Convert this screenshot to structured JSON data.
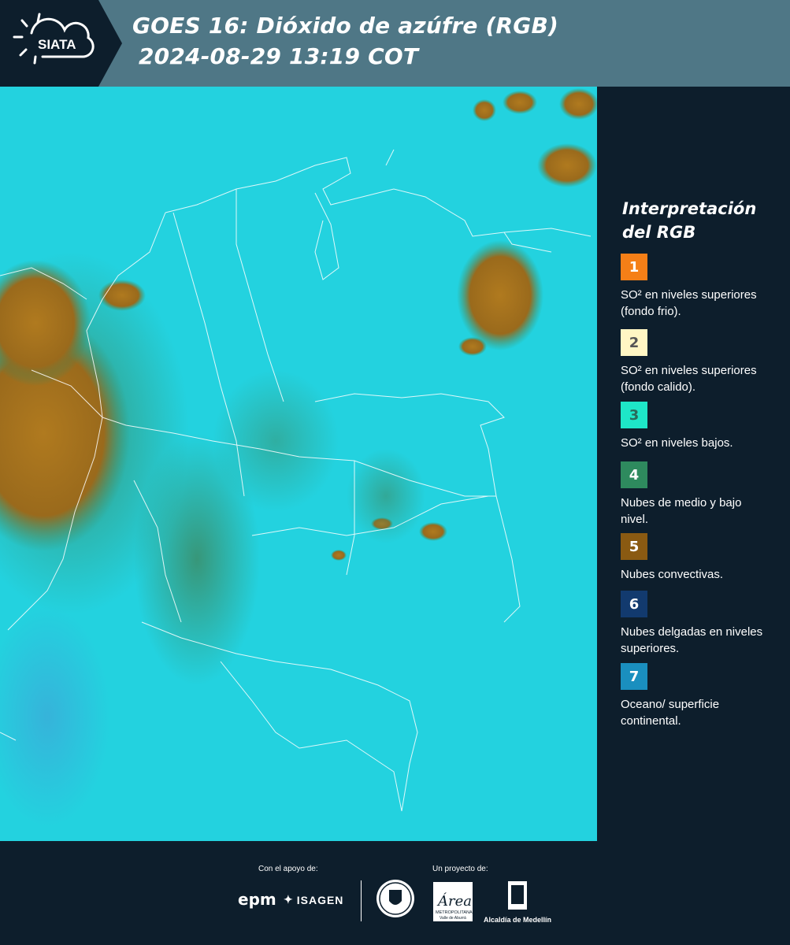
{
  "header": {
    "logo_text": "SIATA",
    "title_line1": "GOES 16: Dióxido de azúfre (RGB)",
    "title_line2": "2024-08-29 13:19 COT"
  },
  "legend": {
    "title_line1": "Interpretación",
    "title_line2": "del RGB",
    "items": [
      {
        "number": "1",
        "color": "#f57f17",
        "text": "SO² en niveles superiores (fondo frio)."
      },
      {
        "number": "2",
        "color": "#fff6c4",
        "text": "SO² en niveles superiores (fondo calido)."
      },
      {
        "number": "3",
        "color": "#1ee6c8",
        "text": "SO² en niveles bajos."
      },
      {
        "number": "4",
        "color": "#2e8a5e",
        "text": "Nubes de medio y bajo nivel."
      },
      {
        "number": "5",
        "color": "#8a5a12",
        "text": "Nubes convectivas."
      },
      {
        "number": "6",
        "color": "#123a6e",
        "text": "Nubes delgadas en niveles superiores."
      },
      {
        "number": "7",
        "color": "#1a8fbf",
        "text": "Oceano/ superficie continental."
      }
    ]
  },
  "footer": {
    "support_label": "Con el apoyo de:",
    "project_label": "Un proyecto de:",
    "epm": "epm",
    "isagen": "ISAGEN",
    "area_text": "METROPOLITANA",
    "area_sub": "Valle de Aburrá",
    "alcaldia": "Alcaldía de Medellín"
  },
  "map": {
    "ocean_color": "#1fd7e3",
    "convective_color": "#a8751f",
    "low_cloud_color": "#3c9c79"
  }
}
